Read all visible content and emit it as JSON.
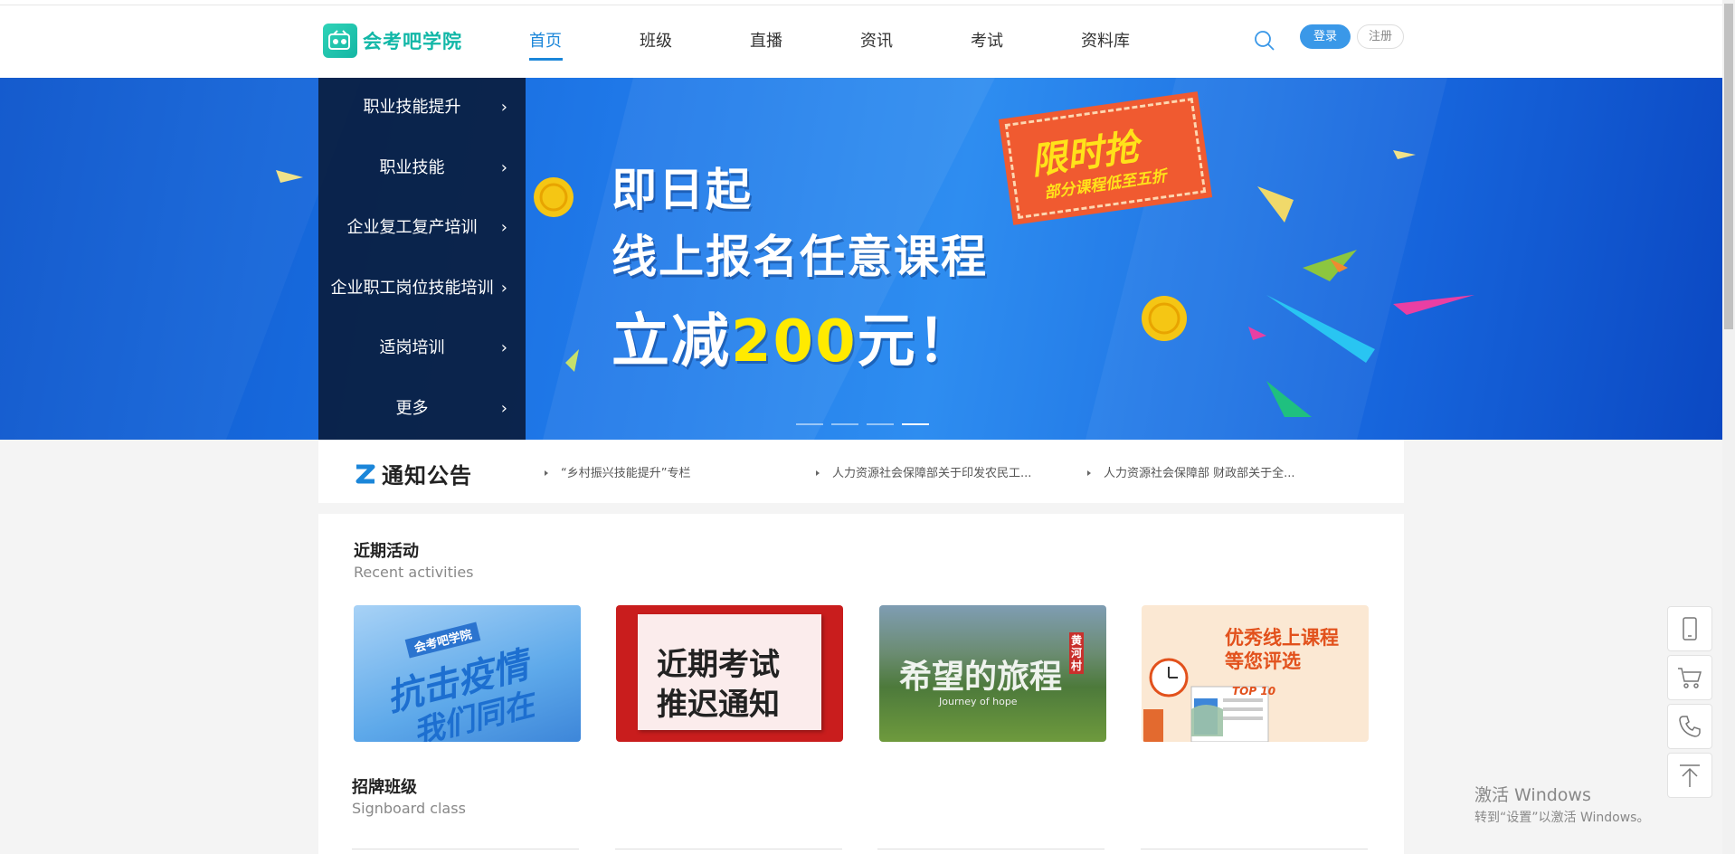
{
  "site": {
    "logo_text": "会考吧学院",
    "logo_mark": "kao"
  },
  "nav": [
    {
      "label": "首页",
      "active": true
    },
    {
      "label": "班级"
    },
    {
      "label": "直播"
    },
    {
      "label": "资讯"
    },
    {
      "label": "考试"
    },
    {
      "label": "资料库"
    }
  ],
  "header": {
    "login_label": "登录",
    "register_label": "注册",
    "search_icon": "search-icon"
  },
  "categories": [
    "职业技能提升",
    "职业技能",
    "企业复工复产培训",
    "企业职工岗位技能培训",
    "适岗培训",
    "更多"
  ],
  "banner": {
    "line1": "即日起",
    "line2": "线上报名任意课程",
    "line3_prefix": "立减",
    "line3_highlight": "200",
    "line3_suffix": "元！",
    "promo_big": "限时抢",
    "promo_small": "部分课程低至五折",
    "slide_count": 4,
    "active_slide": 4
  },
  "notice": {
    "title": "通知公告",
    "items": [
      "“乡村振兴技能提升”专栏",
      "人力资源社会保障部关于印发农民工...",
      "人力资源社会保障部 财政部关于全..."
    ]
  },
  "recent": {
    "title": "近期活动",
    "subtitle": "Recent activities",
    "cards": [
      {
        "tag": "会考吧学院",
        "text1": "抗击疫情",
        "text2": "我们同在"
      },
      {
        "text1": "近期考试",
        "text2": "推迟通知"
      },
      {
        "text1": "希望的旅程",
        "text2": "Journey of hope",
        "tag": "黄河村"
      },
      {
        "text1": "优秀线上课程",
        "text2": "等您评选",
        "tag": "TOP 10"
      }
    ]
  },
  "signboard": {
    "title": "招牌班级",
    "subtitle": "Signboard class"
  },
  "floatbar": [
    "phone-device-icon",
    "cart-icon",
    "telephone-icon",
    "back-to-top-icon"
  ],
  "watermark": {
    "line1": "激活 Windows",
    "line2": "转到“设置”以激活 Windows。"
  },
  "colors": {
    "brand": "#12b7a7",
    "accent": "#1b86d9",
    "banner_blue": "#1f78e8",
    "promo": "#f05a30",
    "highlight": "#ffea00"
  }
}
